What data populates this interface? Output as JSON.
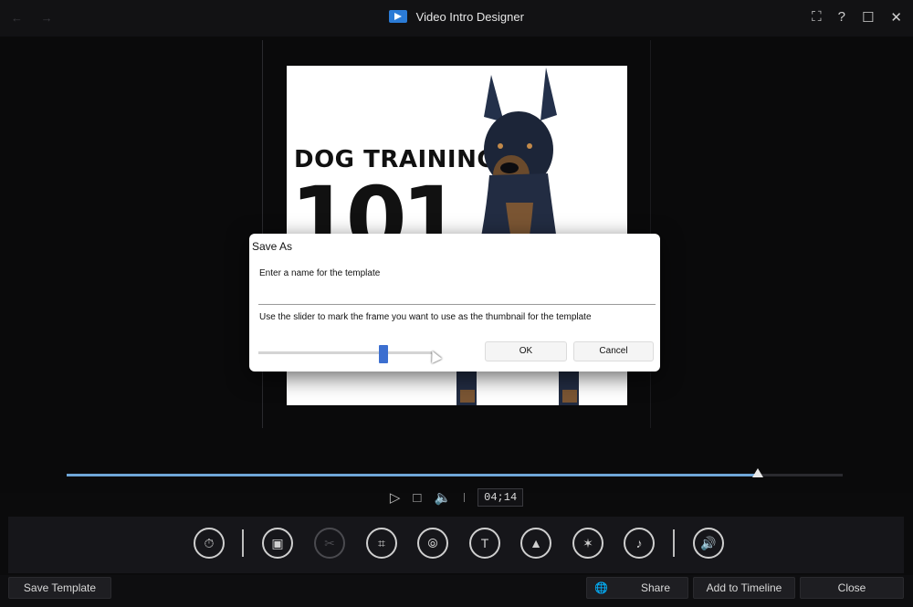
{
  "window": {
    "title": "Video Intro Designer",
    "nav_back": "←",
    "nav_forward": "→",
    "controls": {
      "expand": "⛶",
      "help": "?",
      "maximize": "☐",
      "close": "✕"
    }
  },
  "preview": {
    "headline": "DOG TRAINING",
    "big_number": "101"
  },
  "dialog": {
    "title": "Save As",
    "prompt": "Enter a name for the template",
    "name_value": "",
    "hint": "Use the slider to mark the frame you want to use as the thumbnail for the template",
    "thumbnail_slider_position": 0.72,
    "ok_label": "OK",
    "cancel_label": "Cancel"
  },
  "timeline": {
    "progress": 0.89,
    "timecode": "04;14"
  },
  "transport": {
    "play": "▷",
    "stop": "□",
    "volume": "🔈"
  },
  "toolbar": {
    "tools": [
      {
        "name": "duration-tool",
        "glyph": "⏱",
        "enabled": true
      },
      {
        "name": "layers-tool",
        "glyph": "▣",
        "enabled": true
      },
      {
        "name": "cut-tool",
        "glyph": "✂",
        "enabled": false
      },
      {
        "name": "crop-tool",
        "glyph": "⌗",
        "enabled": true
      },
      {
        "name": "color-tool",
        "glyph": "⦾",
        "enabled": true
      },
      {
        "name": "text-tool",
        "glyph": "T",
        "enabled": true
      },
      {
        "name": "image-tool",
        "glyph": "▲",
        "enabled": true
      },
      {
        "name": "effects-tool",
        "glyph": "✶",
        "enabled": true
      },
      {
        "name": "music-tool",
        "glyph": "♪",
        "enabled": true
      },
      {
        "name": "audio-tool",
        "glyph": "🔊",
        "enabled": true
      }
    ]
  },
  "bottom": {
    "save_template": "Save Template",
    "share": "Share",
    "add_to_timeline": "Add to Timeline",
    "close": "Close"
  },
  "colors": {
    "background": "#0b0b0c",
    "accent": "#3c6fd0",
    "timeline_fill": "#6fa6d8"
  }
}
